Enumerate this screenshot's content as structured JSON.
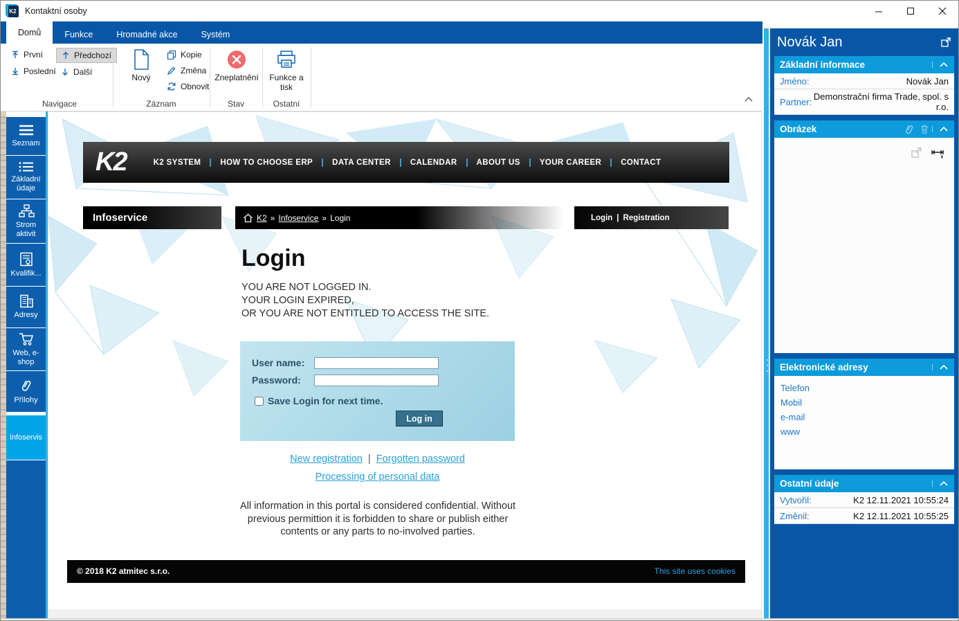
{
  "window": {
    "title": "Kontaktní osoby",
    "app_icon": "K2"
  },
  "ribbon": {
    "tabs": [
      {
        "label": "Domů"
      },
      {
        "label": "Funkce"
      },
      {
        "label": "Hromadné akce"
      },
      {
        "label": "Systém"
      }
    ],
    "navigace": {
      "label": "Navigace",
      "first": "První",
      "last": "Poslední",
      "prev": "Předchozí",
      "next": "Další"
    },
    "zaznam": {
      "label": "Záznam",
      "new": "Nový",
      "copy": "Kopie",
      "change": "Změna",
      "refresh": "Obnovit"
    },
    "stav": {
      "label": "Stav",
      "invalidate": "Zneplatnění"
    },
    "ostatni": {
      "label": "Ostatní",
      "print_line1": "Funkce a",
      "print_line2": "tisk"
    }
  },
  "sidebar": {
    "items": [
      {
        "label": "Seznam"
      },
      {
        "label": "Základní údaje"
      },
      {
        "label": "Strom aktivit"
      },
      {
        "label": "Kvalifik..."
      },
      {
        "label": "Adresy"
      },
      {
        "label": "Web, e-shop"
      },
      {
        "label": "Přílohy"
      },
      {
        "label": "Infoservis"
      }
    ]
  },
  "webview": {
    "nav": {
      "logo": "K2",
      "items": [
        "K2 SYSTEM",
        "HOW TO CHOOSE ERP",
        "DATA CENTER",
        "CALENDAR",
        "ABOUT US",
        "YOUR CAREER",
        "CONTACT"
      ]
    },
    "infoservice_title": "Infoservice",
    "breadcrumb": {
      "home": "K2",
      "sep": "»",
      "level1": "Infoservice",
      "level2": "Login"
    },
    "authbar": {
      "login": "Login",
      "divider": "|",
      "registration": "Registration"
    },
    "heading": "Login",
    "messages": [
      "YOU ARE NOT LOGGED IN.",
      "YOUR LOGIN EXPIRED,",
      "OR YOU ARE NOT ENTITLED TO ACCESS THE SITE."
    ],
    "form": {
      "username_label": "User name:",
      "password_label": "Password:",
      "username_value": "",
      "password_value": "",
      "save_label": "Save Login for next time.",
      "submit_label": "Log in"
    },
    "links": {
      "new_registration": "New registration",
      "divider": "|",
      "forgotten_password": "Forgotten password",
      "processing": "Processing of personal data"
    },
    "confidential": "All information in this portal is considered confidential. Without previous permittion it is forbidden to share or publish either contents or any parts to no-involved parties.",
    "footer": {
      "copyright": "© 2018  K2 atmitec s.r.o.",
      "cookies": "This site uses cookies"
    }
  },
  "panel": {
    "title": "Novák Jan",
    "basic": {
      "title": "Základní informace",
      "rows": [
        {
          "label": "Jméno:",
          "value": "Novák Jan"
        },
        {
          "label": "Partner:",
          "value": "Demonstrační firma Trade, spol. s r.o."
        }
      ]
    },
    "image": {
      "title": "Obrázek"
    },
    "eaddresses": {
      "title": "Elektronické adresy",
      "links": [
        {
          "label": "Telefon"
        },
        {
          "label": "Mobil"
        },
        {
          "label": "e-mail"
        },
        {
          "label": "www"
        }
      ]
    },
    "other": {
      "title": "Ostatní údaje",
      "rows": [
        {
          "label": "Vytvořil:",
          "value": "K2 12.11.2021 10:55:24"
        },
        {
          "label": "Změnil:",
          "value": "K2 12.11.2021 10:55:25"
        }
      ]
    }
  },
  "colors": {
    "accent_blue": "#0857a7",
    "section_header_blue": "#0d9bdb",
    "active_cyan": "#00a5e8",
    "splitter_cyan": "#2fb3e9",
    "link_blue": "#2aa0dc",
    "error_red": "#ee6b6e",
    "login_box_blue": "#a9d8e9",
    "login_button_teal": "#35708c"
  }
}
